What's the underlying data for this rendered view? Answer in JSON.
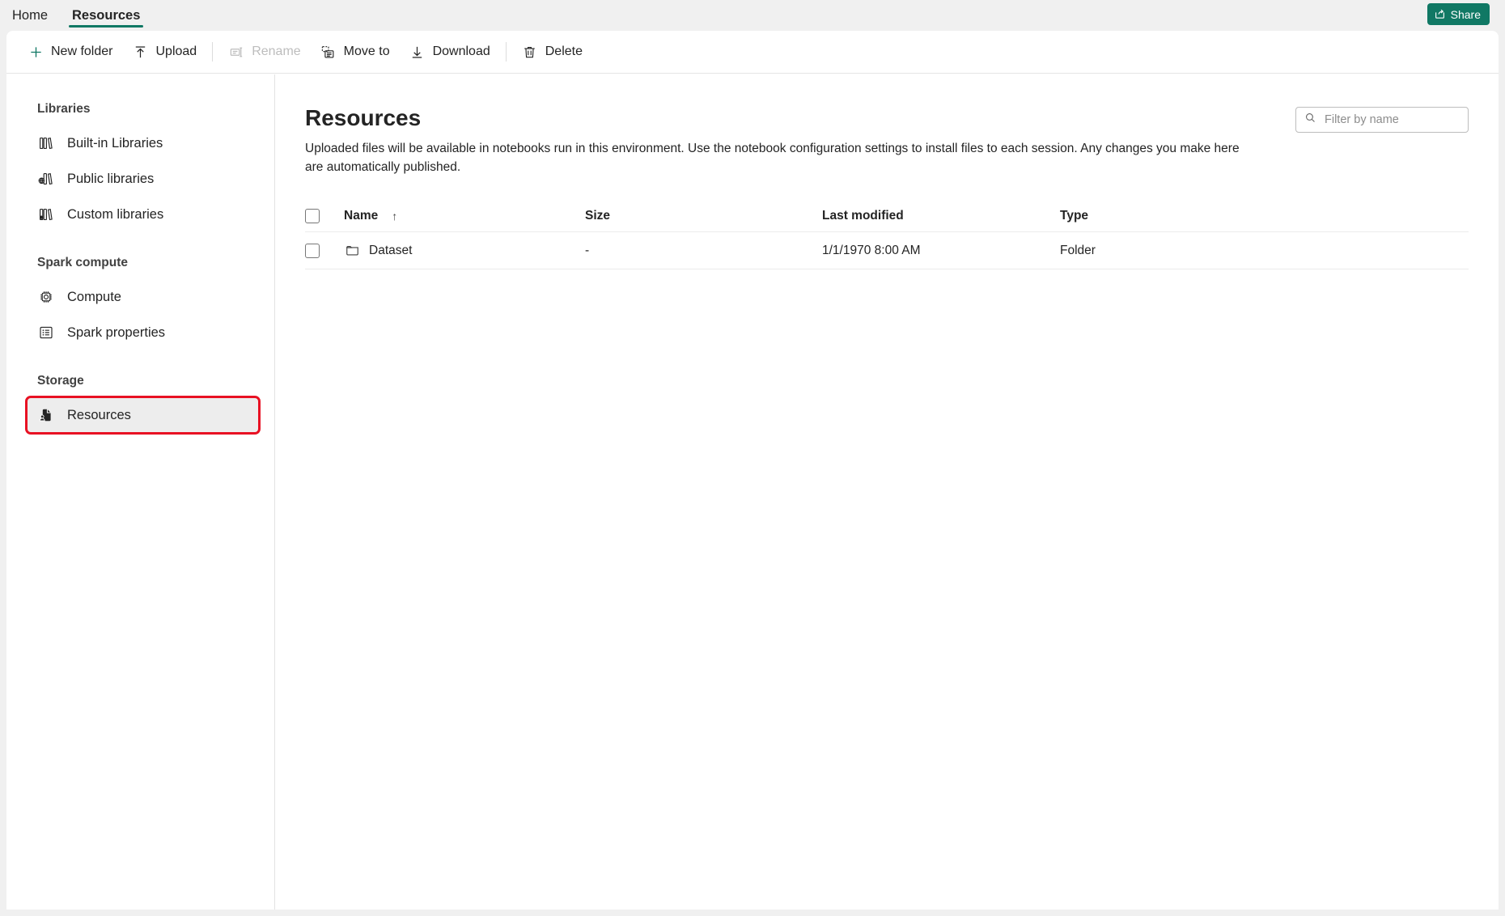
{
  "tabs": [
    {
      "label": "Home",
      "active": false,
      "name": "tab-home"
    },
    {
      "label": "Resources",
      "active": true,
      "name": "tab-resources"
    }
  ],
  "share": {
    "label": "Share",
    "icon": "share-icon",
    "color": "#107864"
  },
  "toolbar": {
    "items": [
      {
        "label": "New folder",
        "icon": "plus-icon",
        "disabled": false
      },
      {
        "label": "Upload",
        "icon": "upload-arrow-icon",
        "disabled": false
      },
      {
        "label": "Rename",
        "icon": "rename-icon",
        "disabled": true
      },
      {
        "label": "Move to",
        "icon": "move-to-icon",
        "disabled": false
      },
      {
        "label": "Download",
        "icon": "download-arrow-icon",
        "disabled": false
      },
      {
        "label": "Delete",
        "icon": "trash-icon",
        "disabled": false
      }
    ]
  },
  "sidebar": {
    "groups": [
      {
        "title": "Libraries",
        "items": [
          {
            "label": "Built-in Libraries",
            "icon": "books-icon",
            "selected": false,
            "highlighted": false
          },
          {
            "label": "Public libraries",
            "icon": "public-books-icon",
            "selected": false,
            "highlighted": false
          },
          {
            "label": "Custom libraries",
            "icon": "custom-books-icon",
            "selected": false,
            "highlighted": false
          }
        ]
      },
      {
        "title": "Spark compute",
        "items": [
          {
            "label": "Compute",
            "icon": "cpu-chip-icon",
            "selected": false,
            "highlighted": false
          },
          {
            "label": "Spark properties",
            "icon": "list-properties-icon",
            "selected": false,
            "highlighted": false
          }
        ]
      },
      {
        "title": "Storage",
        "items": [
          {
            "label": "Resources",
            "icon": "resources-file-icon",
            "selected": true,
            "highlighted": true
          }
        ]
      }
    ]
  },
  "main": {
    "title": "Resources",
    "description": "Uploaded files will be available in notebooks run in this environment. Use the notebook configuration settings to install files to each session. Any changes you make here are automatically published.",
    "filter": {
      "placeholder": "Filter by name",
      "value": "",
      "icon": "search-icon"
    }
  },
  "table": {
    "columns": [
      {
        "label": "Name",
        "sort": "↑"
      },
      {
        "label": "Size",
        "sort": ""
      },
      {
        "label": "Last modified",
        "sort": ""
      },
      {
        "label": "Type",
        "sort": ""
      }
    ],
    "rows": [
      {
        "name": "Dataset",
        "icon": "folder-icon",
        "size": "-",
        "modified": "1/1/1970 8:00 AM",
        "type": "Folder"
      }
    ]
  },
  "colors": {
    "accent": "#107864",
    "highlight": "#e81123",
    "text": "#242424",
    "muted": "#8c8c8c"
  }
}
